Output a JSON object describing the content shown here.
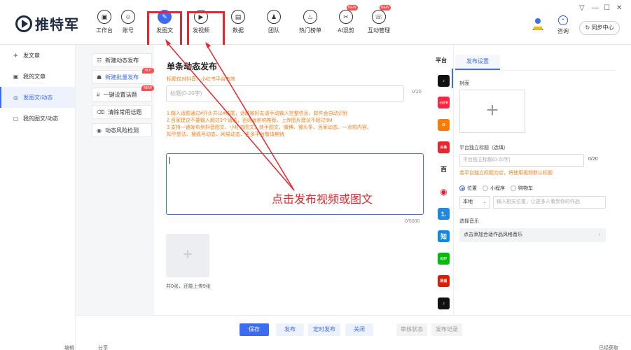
{
  "app": {
    "logo_text": "推特军"
  },
  "nav": [
    {
      "label": "工作台",
      "icon": "chat-bubble-icon",
      "glyph": "▣"
    },
    {
      "label": "账号",
      "icon": "user-icon",
      "glyph": "☺"
    },
    {
      "label": "发图文",
      "icon": "image-post-icon",
      "glyph": "✎"
    },
    {
      "label": "发视频",
      "icon": "play-icon",
      "glyph": "▶"
    },
    {
      "label": "数据",
      "icon": "data-icon",
      "glyph": "▤"
    },
    {
      "label": "团队",
      "icon": "team-icon",
      "glyph": "♟"
    },
    {
      "label": "热门榜单",
      "icon": "flame-icon",
      "glyph": "♨"
    },
    {
      "label": "AI混剪",
      "icon": "ai-edit-icon",
      "glyph": "✂",
      "badge": "NEW"
    },
    {
      "label": "互动管理",
      "icon": "interaction-icon",
      "glyph": "☏",
      "badge": "NEW"
    }
  ],
  "header": {
    "consult_label": "咨询",
    "sync_label": "同步中心",
    "win_controls": [
      "▽",
      "—",
      "☐",
      "✕"
    ]
  },
  "sidebar": [
    {
      "label": "发文章",
      "glyph": "✈"
    },
    {
      "label": "我的文章",
      "glyph": "▣"
    },
    {
      "label": "发图文/动态",
      "glyph": "◎"
    },
    {
      "label": "我的图文/动态",
      "glyph": "▢"
    }
  ],
  "subnav": [
    {
      "label": "新建动态发布",
      "glyph": "☷"
    },
    {
      "label": "新建批量发布",
      "glyph": "☗",
      "tag": "HOT"
    },
    {
      "label": "一键设置话题",
      "glyph": "#",
      "tag": "NEW"
    },
    {
      "label": "清除常用话题",
      "glyph": "⌫"
    },
    {
      "label": "动态风险检测",
      "glyph": "◉"
    }
  ],
  "editor": {
    "title": "单条动态发布",
    "notice": "标题仅对抖音、小红书平台有效",
    "title_placeholder": "标题(0-20字)",
    "title_count": "0/20",
    "tips": [
      "1.输入话题通过#开头并以#结尾，话题和好友请手动输入完整信息，软件会自动识别",
      "2.百家建议不要输入超过3个话题，否则会影响推荐，上传图片建议不超过5M",
      "3.支持一键发布到抖音图文、小红书图文、快手图文、微博、微头条、百家动态、一点短内容、",
      "  知乎想法、搜狐号动态、网易动态、更多平台敬请期待"
    ],
    "body_count": "0/5000",
    "add_symbol": "+",
    "img_note": "共0张，还能上传9张",
    "annotation": "点击发布视频或图文"
  },
  "platforms": {
    "header": "平台",
    "items": [
      {
        "name": "douyin",
        "glyph": "♪",
        "color": "#111111"
      },
      {
        "name": "xiaohongshu",
        "glyph": "小红书",
        "color": "#ff2442"
      },
      {
        "name": "kuaishou",
        "glyph": "✿",
        "color": "#ff7a00"
      },
      {
        "name": "toutiao",
        "glyph": "头条",
        "color": "#e8262c"
      },
      {
        "name": "baijiahao",
        "glyph": "百",
        "color": "#ffffff"
      },
      {
        "name": "weibo",
        "glyph": "◉",
        "color": "#ff8200"
      },
      {
        "name": "yidian",
        "glyph": "1.",
        "color": "#1e88e5"
      },
      {
        "name": "zhihu",
        "glyph": "知",
        "color": "#0f88eb"
      },
      {
        "name": "iqiyi",
        "glyph": "iQIY",
        "color": "#00be06"
      },
      {
        "name": "wangyi",
        "glyph": "网易",
        "color": "#d81e06"
      },
      {
        "name": "douyin-2",
        "glyph": "♪",
        "color": "#111111"
      }
    ]
  },
  "settings": {
    "tab": "发布设置",
    "cover_label": "封面",
    "cover_symbol": "+",
    "subtitle_label": "平台独立标题（选填）",
    "subtitle_placeholder": "平台独立标题(0-20字)",
    "subtitle_count": "0/20",
    "subtitle_warn": "若平台独立标题为空，将使用视频默认标题",
    "options": [
      "位置",
      "小程序",
      "购物车"
    ],
    "location_select": "本地",
    "location_placeholder": "输入相关位置，让更多人看到你的作品",
    "music_label": "选择音乐",
    "music_row": "点击添加合适作品风格音乐",
    "music_arrow": "›"
  },
  "bottom": {
    "buttons": [
      "保存",
      "发布",
      "定时发布",
      "关闭",
      "审核状态",
      "发布记录"
    ]
  },
  "underlay": [
    "编辑",
    "分享",
    "已经获取"
  ]
}
